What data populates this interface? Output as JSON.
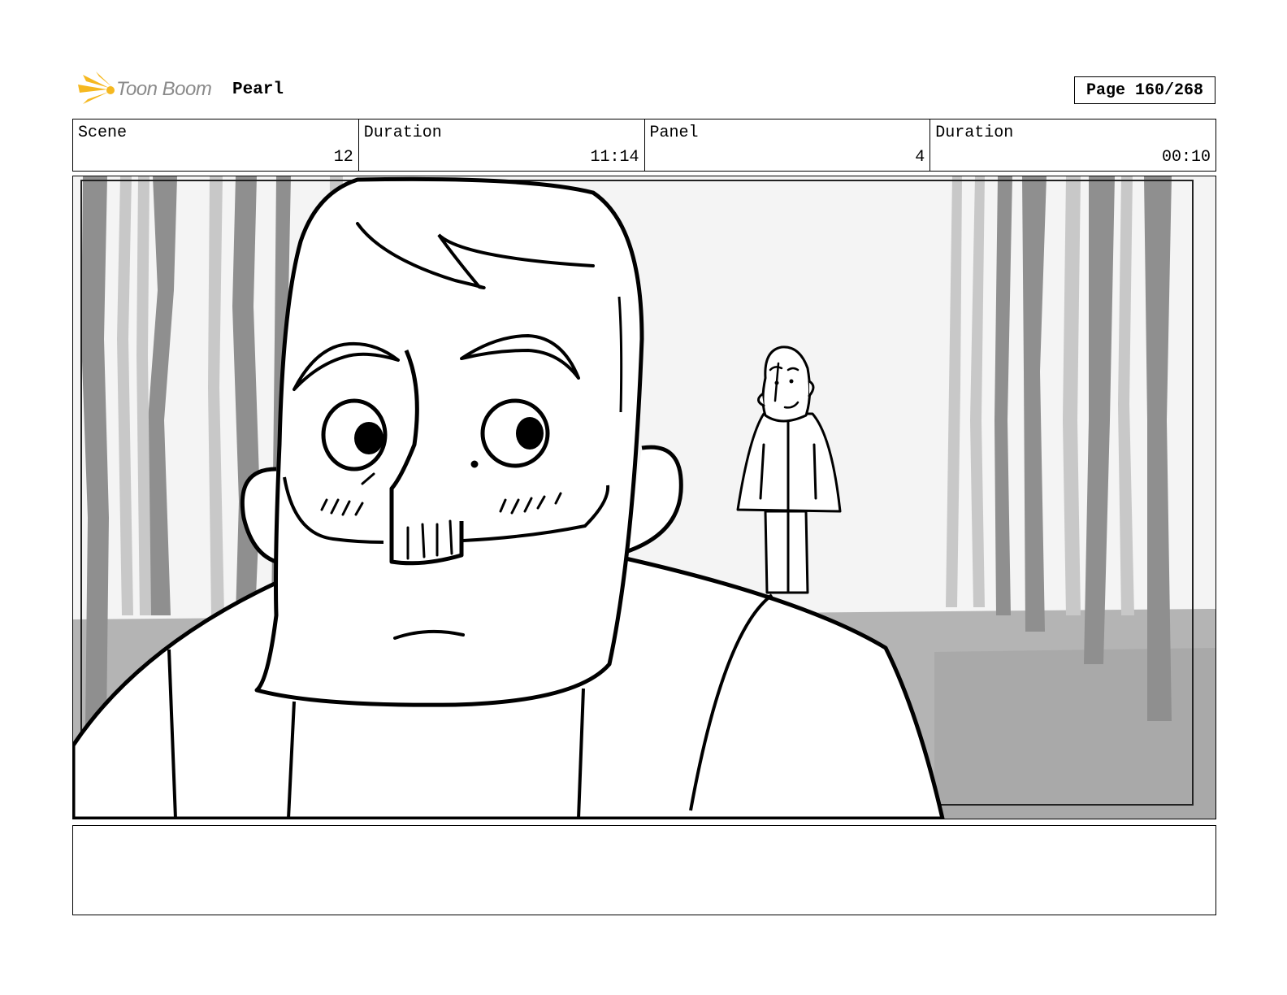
{
  "header": {
    "logo_text": "Toon Boom",
    "project": "Pearl",
    "page": "Page 160/268"
  },
  "info": {
    "scene_label": "Scene",
    "scene_value": "12",
    "scene_duration_label": "Duration",
    "scene_duration_value": "11:14",
    "panel_label": "Panel",
    "panel_value": "4",
    "panel_duration_label": "Duration",
    "panel_duration_value": "00:10"
  },
  "colors": {
    "logo_accent": "#f5b820",
    "forest_dark": "#8f8f8f",
    "forest_light": "#c8c8c8",
    "ground": "#b4b4b4",
    "sky": "#f4f4f4"
  }
}
